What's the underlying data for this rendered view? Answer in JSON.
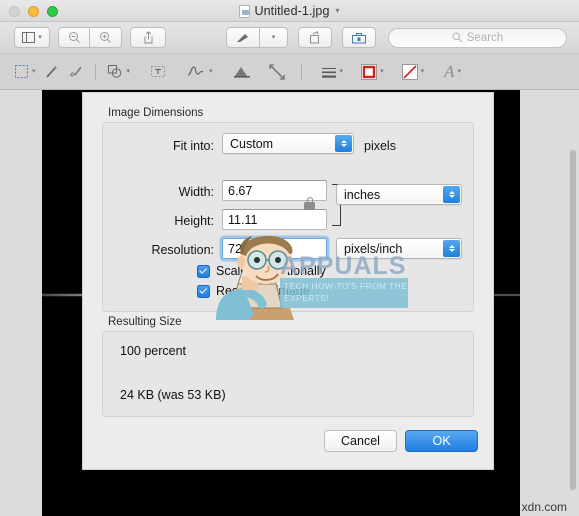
{
  "window": {
    "document_title": "Untitled-1.jpg",
    "title_chevron": "chevron-down",
    "traffic_lights": [
      "close",
      "minimize",
      "zoom"
    ]
  },
  "toolbar": {
    "sidebar_button": "sidebar-icon",
    "zoom_out_button": "zoom-out-icon",
    "zoom_in_button": "zoom-in-icon",
    "share_button": "share-icon",
    "markup_button": "markup-pen-icon",
    "rotate_button": "rotate-icon",
    "toolbox_button": "toolbox-icon",
    "search": {
      "placeholder": "Search",
      "value": ""
    }
  },
  "markup_toolbar": {
    "items": [
      {
        "name": "selection-tool",
        "icon": "dashed-rectangle-icon",
        "has_menu": true
      },
      {
        "name": "instant-alpha-tool",
        "icon": "magic-wand-icon",
        "has_menu": false
      },
      {
        "name": "sketch-tool",
        "icon": "sketch-pen-icon",
        "has_menu": false
      },
      {
        "name": "shapes-tool",
        "icon": "shapes-icon",
        "has_menu": true
      },
      {
        "name": "text-tool",
        "icon": "text-box-icon",
        "has_menu": false
      },
      {
        "name": "sign-tool",
        "icon": "signature-icon",
        "has_menu": true
      },
      {
        "name": "adjust-color-tool",
        "icon": "adjust-color-icon",
        "has_menu": false
      },
      {
        "name": "adjust-size-tool",
        "icon": "adjust-size-icon",
        "has_menu": false
      },
      {
        "name": "shape-style-tool",
        "icon": "line-thickness-icon",
        "has_menu": true
      },
      {
        "name": "border-color-tool",
        "icon": "border-color-swatch-icon",
        "has_menu": true
      },
      {
        "name": "fill-color-tool",
        "icon": "fill-color-swatch-icon",
        "has_menu": true
      },
      {
        "name": "text-style-tool",
        "icon": "font-a-icon",
        "has_menu": true
      }
    ]
  },
  "dialog": {
    "image_dimensions": {
      "group_title": "Image Dimensions",
      "fit_into_label": "Fit into:",
      "fit_into_value": "Custom",
      "fit_into_suffix": "pixels",
      "width_label": "Width:",
      "width_value": "6.67",
      "height_label": "Height:",
      "height_value": "11.11",
      "size_unit_value": "inches",
      "resolution_label": "Resolution:",
      "resolution_value": "72",
      "resolution_unit_value": "pixels/inch",
      "lock_icon": "closed-padlock-icon",
      "scale_proportionally_label": "Scale proportionally",
      "scale_proportionally_checked": true,
      "resample_image_label": "Resample image",
      "resample_image_checked": true
    },
    "resulting_size": {
      "group_title": "Resulting Size",
      "percent_line": "100 percent",
      "size_line": "24 KB (was 53 KB)"
    },
    "buttons": {
      "cancel": "Cancel",
      "ok": "OK"
    }
  },
  "watermark": {
    "brand": "APPUALS",
    "tagline": "TECH HOW-TO'S FROM THE EXPERTS!",
    "corner_text": "xdn.com"
  },
  "colors": {
    "accent_blue": "#1f7fe2",
    "window_chrome": "#d6d6d6",
    "dialog_bg": "#ececec",
    "group_bg": "#e6e6e6",
    "photo_bg": "#000000",
    "watermark_blue": "#8fa7c4",
    "watermark_band": "#7fc0d4"
  }
}
